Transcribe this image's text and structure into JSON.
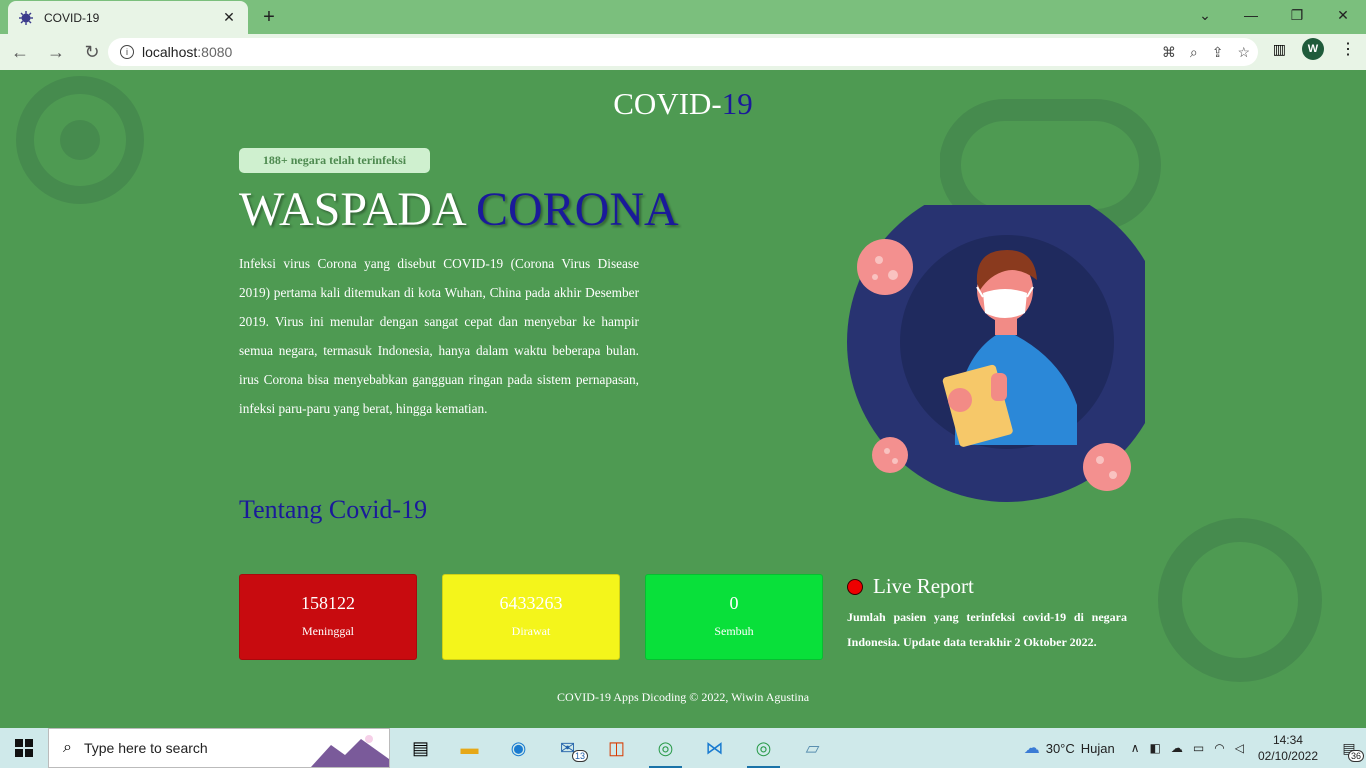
{
  "browser": {
    "tab_title": "COVID-19",
    "url_host": "localhost",
    "url_port": ":8080",
    "profile_initial": "W"
  },
  "page": {
    "brand_text": "COVID-",
    "brand_num": "19",
    "badge": "188+ negara telah terinfeksi",
    "headline_part1": "WASPADA ",
    "headline_part2": "CORONA",
    "description": "Infeksi virus Corona yang disebut COVID-19 (Corona Virus Disease 2019) pertama kali ditemukan di kota Wuhan, China pada akhir Desember 2019. Virus ini menular dengan sangat cepat dan menyebar ke hampir semua negara, termasuk Indonesia, hanya dalam waktu beberapa bulan. irus Corona bisa menyebabkan gangguan ringan pada sistem pernapasan, infeksi paru-paru yang berat, hingga kematian.",
    "about_link": "Tentang Covid-19",
    "stats": [
      {
        "value": "158122",
        "label": "Meninggal",
        "color": "#c80b0f"
      },
      {
        "value": "6433263",
        "label": "Dirawat",
        "color": "#f4f51b"
      },
      {
        "value": "0",
        "label": "Sembuh",
        "color": "#09e03a"
      }
    ],
    "live_title": "Live Report",
    "live_text": "Jumlah pasien yang terinfeksi covid-19 di negara Indonesia. Update data terakhir 2 Oktober 2022.",
    "footer": "COVID-19 Apps Dicoding © 2022, Wiwin Agustina"
  },
  "taskbar": {
    "search_placeholder": "Type here to search",
    "mail_badge": "13",
    "weather_temp": "30°C",
    "weather_desc": "Hujan",
    "time": "14:34",
    "date": "02/10/2022",
    "notif_count": "36"
  },
  "colors": {
    "page_bg": "#4e9a52",
    "accent_blue": "#1a1a9a",
    "hero_circle": "#283371"
  }
}
